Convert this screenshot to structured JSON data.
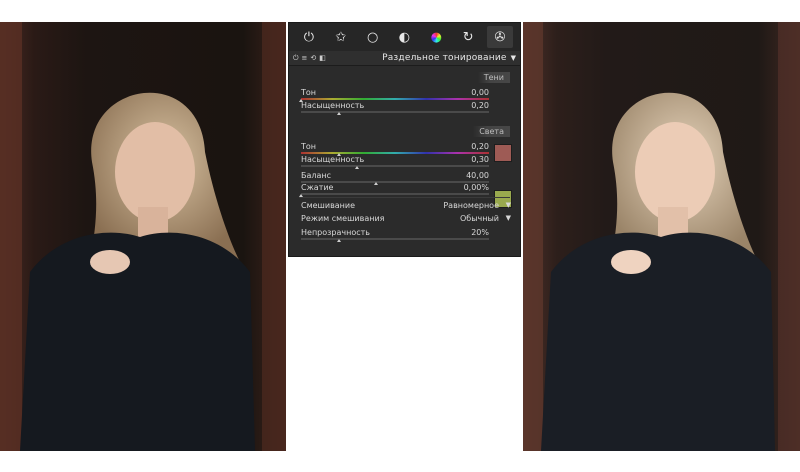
{
  "toolbar": {
    "tabs": [
      {
        "icon": "power-icon",
        "glyph": "⏻"
      },
      {
        "icon": "star-icon",
        "glyph": "✩"
      },
      {
        "icon": "circle-icon",
        "glyph": "○"
      },
      {
        "icon": "half-circle-icon",
        "glyph": "◐"
      },
      {
        "icon": "color-wheel-icon",
        "glyph": "●"
      },
      {
        "icon": "effects-icon",
        "glyph": "↻"
      },
      {
        "icon": "film-reel-icon",
        "glyph": "✇"
      }
    ]
  },
  "module": {
    "title": "Раздельное тонирование",
    "expand_glyph": "▼"
  },
  "shadows": {
    "label": "Тени",
    "hue": {
      "label": "Тон",
      "value": "0,00",
      "level": 0.0
    },
    "saturation": {
      "label": "Насыщенность",
      "value": "0,20",
      "level": 0.2
    },
    "swatch_color": "#9e5b55"
  },
  "highlights": {
    "label": "Света",
    "hue": {
      "label": "Тон",
      "value": "0,20",
      "level": 0.2
    },
    "saturation": {
      "label": "Насыщенность",
      "value": "0,30",
      "level": 0.3
    },
    "swatch_color": "#99a94e"
  },
  "balance": {
    "label": "Баланс",
    "value": "40,00",
    "level": 0.4
  },
  "compress": {
    "label": "Сжатие",
    "value": "0,00%",
    "level": 0.0
  },
  "blend": {
    "blending": {
      "label": "Смешивание",
      "value": "Равномерное"
    },
    "blend_mode": {
      "label": "Режим смешивания",
      "value": "Обычный"
    },
    "opacity": {
      "label": "Непрозрачность",
      "value": "20%",
      "level": 0.2
    }
  },
  "colors": {
    "panel_bg": "#2b2b2b",
    "shadows_swatch": "#9e5b55",
    "highlights_swatch": "#99a94e"
  }
}
